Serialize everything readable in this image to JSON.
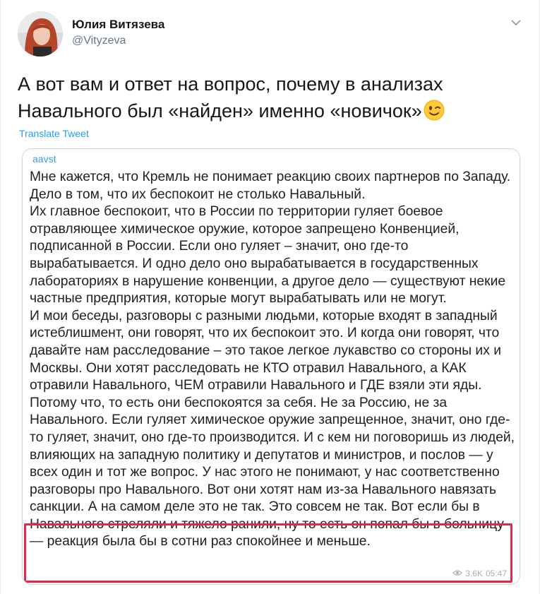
{
  "author": {
    "display_name": "Юлия Витязева",
    "handle": "@Vityzeva"
  },
  "tweet": {
    "text": "А вот вам и ответ на вопрос, почему в анализах Навального был «найден» именно «новичок»",
    "emoji_icon": "winking-face-icon",
    "translate_label": "Translate Tweet"
  },
  "embedded_post": {
    "channel": "aavst",
    "body": "Мне кажется, что Кремль не понимает реакцию своих партнеров по Западу. Дело в том, что их беспокоит не столько Навальный.\nИх главное беспокоит, что в России по территории гуляет боевое отравляющее химическое оружие, которое запрещено Конвенцией, подписанной в России. Если оно гуляет – значит, оно где-то вырабатывается. И одно дело оно вырабатывается в государственных лабораториях в нарушение конвенции, а другое дело — существуют некие частные предприятия, которые могут вырабатывать или не могут.\nИ мои беседы, разговоры с разными людьми, которые входят в западный истеблишмент, они говорят, что их беспокоит это. И когда они говорят, что давайте нам расследование – это такое легкое лукавство со стороны их и Москвы. Они хотят расследовать не КТО отравил Навального, а КАК отравили Навального, ЧЕМ отравили Навального и ГДЕ взяли эти яды. Потому что, то есть они беспокоятся за себя. Не за Россию, не за Навального. Если гуляет химическое оружие запрещенное, значит, оно где-то гуляет, значит, оно где-то производится. И с кем ни поговоришь из людей, влияющих на западную политику и депутатов и министров, и послов — у всех один и тот же вопрос. У нас этого не понимают, у нас соответственно разговоры про Навального. Вот они хотят нам из-за Навального навязать санкции. А на самом деле это не так. Это совсем не так. Вот если бы в Навального стреляли и тяжело ранили, ну то есть он попал бы в больницу — реакция была бы в сотни раз спокойнее и меньше.",
    "views": "3,6K",
    "time": "05:47"
  },
  "colors": {
    "link": "#1da1f2",
    "channel": "#3a9fd6",
    "highlight": "#e0284a",
    "secondary": "#657786"
  }
}
